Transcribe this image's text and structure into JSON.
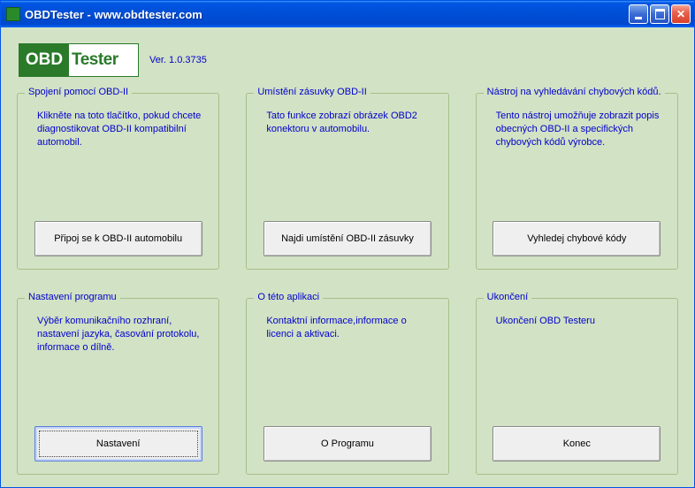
{
  "window": {
    "title": "OBDTester - www.obdtester.com"
  },
  "header": {
    "logo_left": "OBD",
    "logo_right": "Tester",
    "version": "Ver. 1.0.3735"
  },
  "panels": {
    "connect": {
      "title": "Spojení pomocí OBD-II",
      "desc": "Klikněte na toto tlačítko, pokud chcete diagnostikovat OBD-II kompatibilní automobil.",
      "button": "Připoj se k OBD-II automobilu"
    },
    "locate": {
      "title": "Umístění zásuvky OBD-II",
      "desc": "Tato funkce zobrazí obrázek OBD2 konektoru v automobilu.",
      "button": "Najdi umístění OBD-II zásuvky"
    },
    "lookup": {
      "title": "Nástroj na vyhledávání chybových kódů.",
      "desc": "Tento nástroj umožňuje zobrazit popis obecných OBD-II a specifických chybových kódů výrobce.",
      "button": "Vyhledej chybové kódy"
    },
    "settings": {
      "title": "Nastavení programu",
      "desc": "Výběr komunikačního rozhraní, nastavení jazyka, časování protokolu, informace o dílně.",
      "button": "Nastavení"
    },
    "about": {
      "title": "O této aplikaci",
      "desc": "Kontaktní informace,informace o licenci a aktivaci.",
      "button": "O Programu"
    },
    "exit": {
      "title": "Ukončení",
      "desc": "Ukončení OBD Testeru",
      "button": "Konec"
    }
  }
}
